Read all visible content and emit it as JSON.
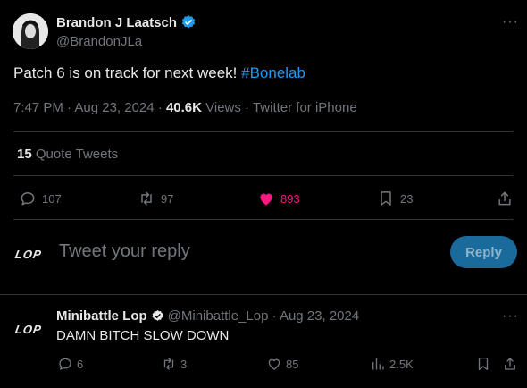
{
  "tweet": {
    "author_name": "Brandon J Laatsch",
    "author_handle": "@BrandonJLa",
    "text_main": "Patch 6 is on track for next week! ",
    "hashtag": "#Bonelab",
    "time": "7:47 PM · Aug 23, 2024 · ",
    "views_count": "40.6K",
    "views_label": " Views · Twitter for iPhone",
    "quote_count": "15",
    "quote_label": " Quote Tweets",
    "more": "···"
  },
  "actions": {
    "replies": "107",
    "retweets": "97",
    "likes": "893",
    "bookmarks": "23"
  },
  "compose": {
    "placeholder": "Tweet your reply",
    "reply_button": "Reply",
    "logo": "LOP"
  },
  "reply": {
    "author_name": "Minibattle Lop",
    "author_handle_time": "@Minibattle_Lop · Aug 23, 2024",
    "text": "DAMN BITCH SLOW DOWN",
    "logo": "LOP",
    "more": "···",
    "replies": "6",
    "retweets": "3",
    "likes": "85",
    "views": "2.5K"
  },
  "colors": {
    "background": "#000000",
    "accent": "#1d9bf0",
    "like": "#f91880"
  }
}
